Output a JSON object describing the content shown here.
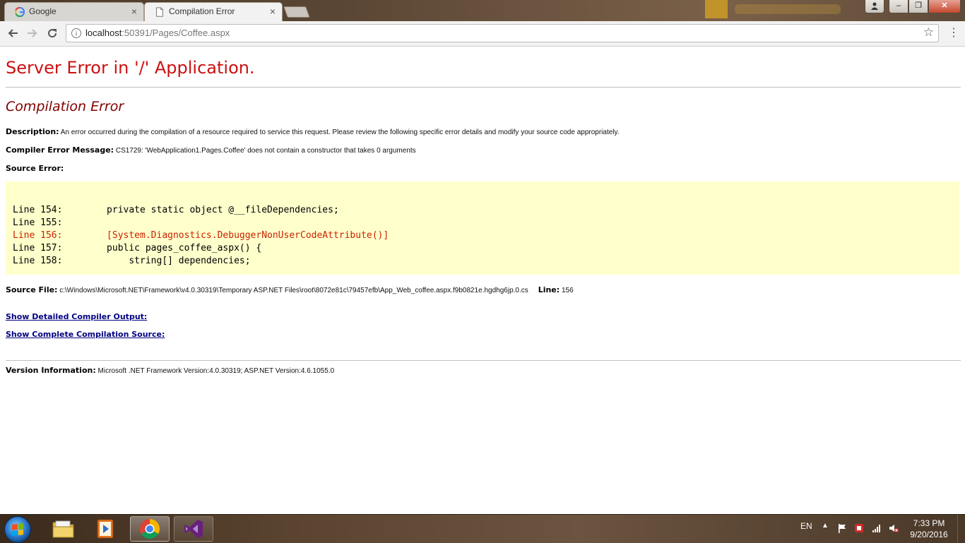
{
  "browser": {
    "tabs": [
      {
        "title": "Google",
        "close": "×"
      },
      {
        "title": "Compilation Error",
        "close": "×"
      }
    ],
    "address": {
      "host": "localhost",
      "path": ":50391/Pages/Coffee.aspx"
    },
    "window_buttons": {
      "minimize": "–",
      "maximize": "❐",
      "close": "✕"
    }
  },
  "page": {
    "title": "Server Error in '/' Application.",
    "subtitle": "Compilation Error",
    "description_label": "Description:",
    "description_text": "An error occurred during the compilation of a resource required to service this request. Please review the following specific error details and modify your source code appropriately.",
    "compiler_msg_label": "Compiler Error Message:",
    "compiler_msg_text": "CS1729: 'WebApplication1.Pages.Coffee' does not contain a constructor that takes 0 arguments",
    "source_error_label": "Source Error:",
    "code_lines": [
      {
        "text": "Line 154:        private static object @__fileDependencies;",
        "error": false
      },
      {
        "text": "Line 155:",
        "error": false
      },
      {
        "text": "Line 156:        [System.Diagnostics.DebuggerNonUserCodeAttribute()]",
        "error": true
      },
      {
        "text": "Line 157:        public pages_coffee_aspx() {",
        "error": false
      },
      {
        "text": "Line 158:            string[] dependencies;",
        "error": false
      }
    ],
    "source_file_label": "Source File:",
    "source_file_path": "c:\\Windows\\Microsoft.NET\\Framework\\v4.0.30319\\Temporary ASP.NET Files\\root\\8072e81c\\79457efb\\App_Web_coffee.aspx.f9b0821e.hgdhg6jp.0.cs",
    "line_label": "Line:",
    "line_value": "156",
    "link_compiler_output": "Show Detailed Compiler Output:",
    "link_compilation_source": "Show Complete Compilation Source:",
    "version_label": "Version Information:",
    "version_text": "Microsoft .NET Framework Version:4.0.30319; ASP.NET Version:4.6.1055.0"
  },
  "taskbar": {
    "language": "EN",
    "time": "7:33 PM",
    "date": "9/20/2016"
  },
  "colors": {
    "title_red": "#cc1111",
    "subtitle_maroon": "#800000",
    "code_bg": "#ffffcc",
    "code_error": "#cc2200",
    "link_navy": "#000080"
  }
}
